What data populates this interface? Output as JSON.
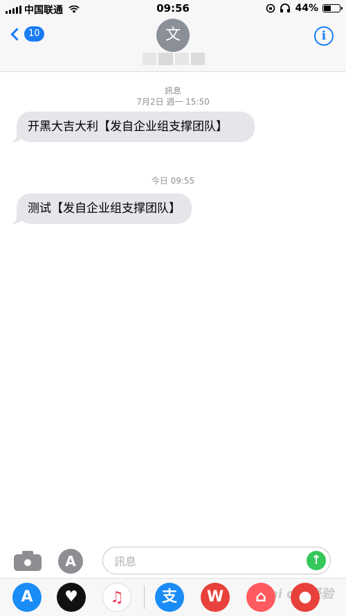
{
  "status_bar": {
    "carrier": "中国联通",
    "time": "09:56",
    "battery": "44%",
    "battery_level": 0.44
  },
  "header": {
    "back_count": "10",
    "avatar_letter": "文"
  },
  "thread": {
    "label": "訊息",
    "messages": [
      {
        "timestamp": "7月2日 週一 15:50",
        "text": "开黑大吉大利【发自企业组支撑团队】"
      },
      {
        "timestamp": "今日 09:55",
        "text": "测试【发自企业组支撑团队】"
      }
    ]
  },
  "composer": {
    "placeholder": "訊息"
  },
  "apps": [
    {
      "name": "App Store",
      "icon": "appstore-icon",
      "color": "#1a8cf5",
      "glyph": "A"
    },
    {
      "name": "Digital Touch",
      "icon": "digital-touch-icon",
      "color": "#111111",
      "glyph": "♥"
    },
    {
      "name": "Music",
      "icon": "music-icon",
      "color": "#ffffff",
      "glyph": "♫"
    },
    {
      "name": "Alipay",
      "icon": "alipay-icon",
      "color": "#1a8cf5",
      "glyph": "支"
    },
    {
      "name": "WPS",
      "icon": "wps-icon",
      "color": "#e8403a",
      "glyph": "W"
    },
    {
      "name": "Airbnb",
      "icon": "airbnb-icon",
      "color": "#ff5a5f",
      "glyph": "⌂"
    },
    {
      "name": "Panda app",
      "icon": "panda-icon",
      "color": "#e8403a",
      "glyph": "●"
    }
  ],
  "watermark": "Bai du 经验"
}
